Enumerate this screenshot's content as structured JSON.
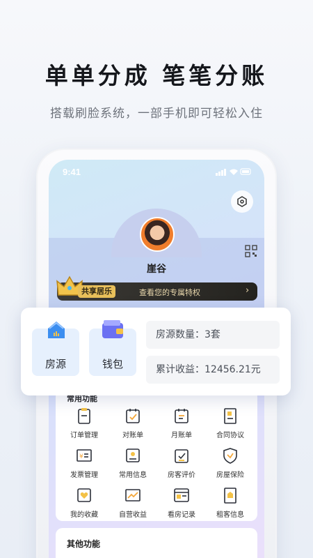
{
  "headline": "单单分成 笔笔分账",
  "subline": "搭载刷脸系统，一部手机即可轻松入住",
  "status_bar": {
    "time": "9:41"
  },
  "profile": {
    "name": "崖谷"
  },
  "vip": {
    "tag": "共享居乐",
    "text": "查看您的专属特权",
    "arrow": "›"
  },
  "quick_tiles": [
    {
      "label": "房源",
      "icon": "house-icon"
    },
    {
      "label": "钱包",
      "icon": "wallet-icon"
    }
  ],
  "stats": [
    {
      "label": "房源数量：3套"
    },
    {
      "label": "累计收益：12456.21元"
    }
  ],
  "common_functions": {
    "title": "常用功能",
    "items": [
      {
        "label": "订单管理",
        "icon": "clipboard-icon"
      },
      {
        "label": "对账单",
        "icon": "calendar-check-icon"
      },
      {
        "label": "月账单",
        "icon": "calendar-icon"
      },
      {
        "label": "合同协议",
        "icon": "contract-icon"
      },
      {
        "label": "发票管理",
        "icon": "invoice-icon"
      },
      {
        "label": "常用信息",
        "icon": "id-card-icon"
      },
      {
        "label": "房客评价",
        "icon": "review-icon"
      },
      {
        "label": "房屋保险",
        "icon": "shield-icon"
      },
      {
        "label": "我的收藏",
        "icon": "heart-icon"
      },
      {
        "label": "自营收益",
        "icon": "chart-icon"
      },
      {
        "label": "看房记录",
        "icon": "record-icon"
      },
      {
        "label": "租客信息",
        "icon": "tenant-icon"
      }
    ]
  },
  "other_functions": {
    "title": "其他功能"
  },
  "colors": {
    "accent": "#4a90e2",
    "vip_gold": "#e8bf5a",
    "icon_stroke": "#2b2f38"
  }
}
